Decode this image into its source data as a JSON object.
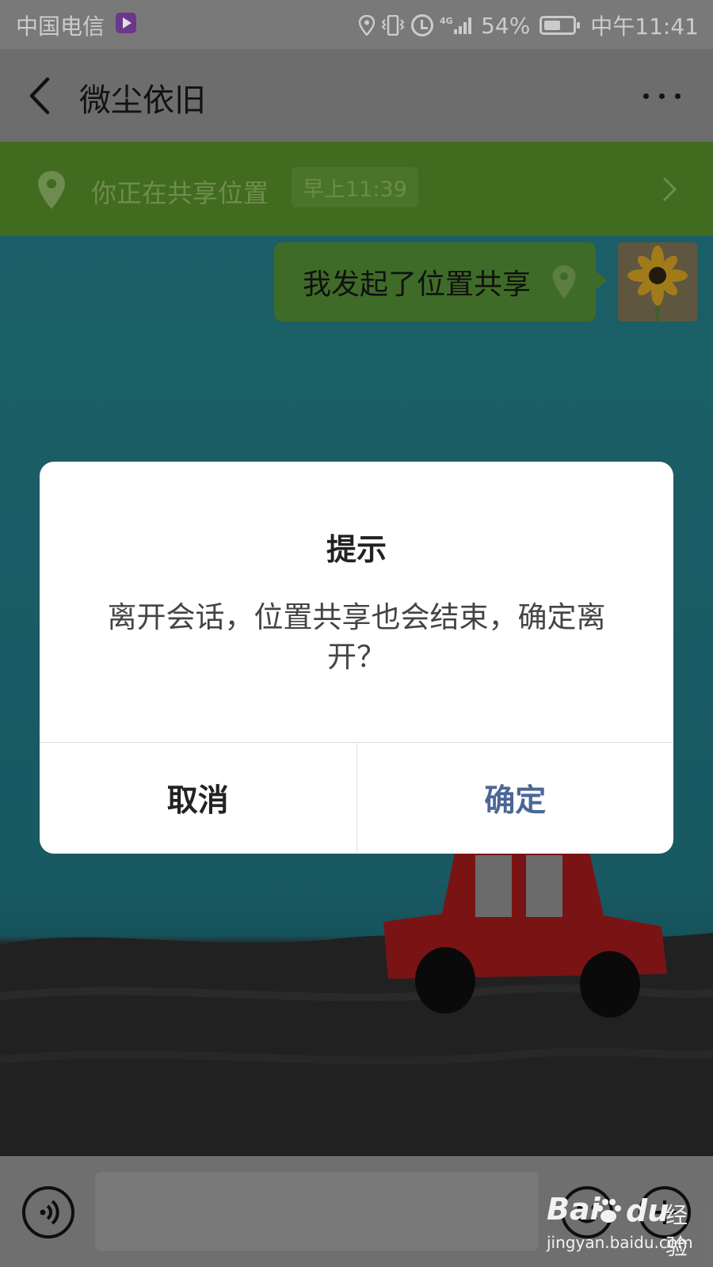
{
  "status_bar": {
    "carrier": "中国电信",
    "battery": "54%",
    "network": "4G",
    "time": "中午11:41",
    "icons": [
      "video-app-icon",
      "location-icon",
      "vibrate-icon",
      "alarm-icon",
      "signal-icon",
      "battery-icon"
    ]
  },
  "header": {
    "title": "微尘依旧",
    "back_icon": "back-arrow-icon",
    "more_icon": "more-dots-icon"
  },
  "location_banner": {
    "text": "你正在共享位置",
    "time": "早上11:39",
    "icon": "location-pin-icon"
  },
  "messages": [
    {
      "text": "我发起了位置共享",
      "icon": "location-pin-icon",
      "sender": "self"
    }
  ],
  "dialog": {
    "title": "提示",
    "body": "离开会话，位置共享也会结束，确定离开？",
    "cancel_label": "取消",
    "confirm_label": "确定"
  },
  "input_bar": {
    "voice_icon": "voice-icon",
    "emoji_icon": "emoji-icon",
    "plus_icon": "plus-icon"
  },
  "watermark": {
    "brand_left": "Bai",
    "brand_right": "du",
    "brand_cn": "经验",
    "url": "jingyan.baidu.com"
  },
  "colors": {
    "status_bar_bg": "#8a8a8a",
    "title_bar_bg": "#7d7d7d",
    "banner_bg": "#4a7a24",
    "bubble_bg": "#487a2e",
    "dialog_confirm": "#4a6795",
    "chat_bg": "#1f6c76"
  }
}
